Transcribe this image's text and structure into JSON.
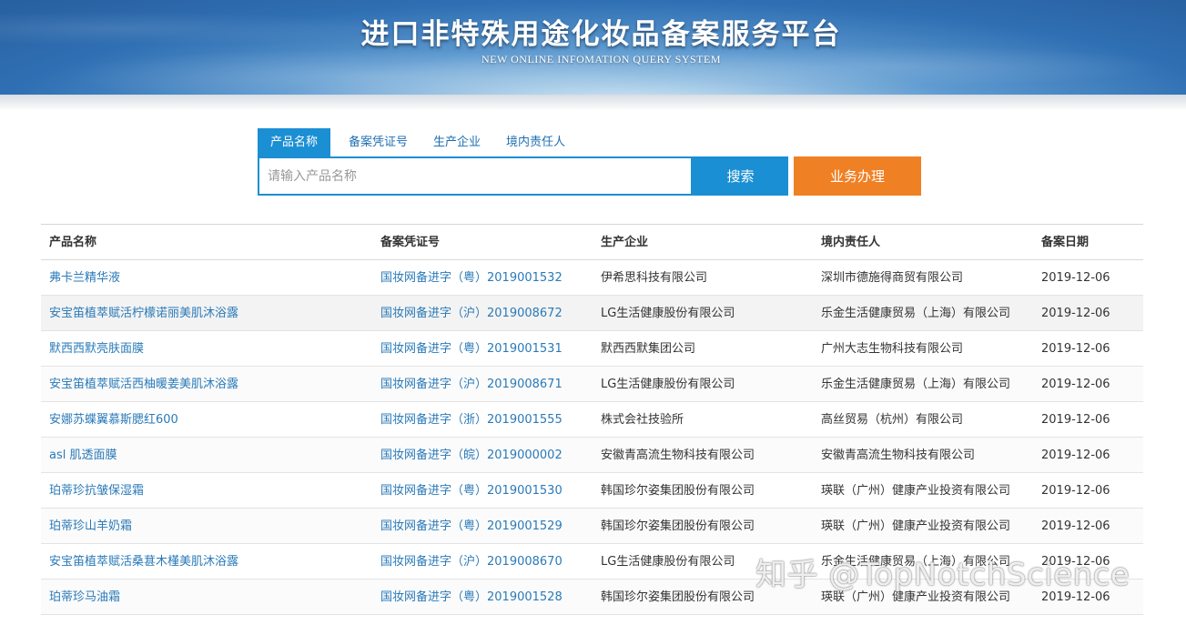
{
  "header": {
    "title": "进口非特殊用途化妆品备案服务平台",
    "subtitle": "NEW ONLINE INFOMATION QUERY SYSTEM"
  },
  "tabs": [
    {
      "label": "产品名称",
      "active": true
    },
    {
      "label": "备案凭证号",
      "active": false
    },
    {
      "label": "生产企业",
      "active": false
    },
    {
      "label": "境内责任人",
      "active": false
    }
  ],
  "search": {
    "placeholder": "请输入产品名称",
    "value": "",
    "button_label": "搜索"
  },
  "business_button_label": "业务办理",
  "colors": {
    "accent_blue": "#1b8fd3",
    "accent_orange": "#f08024",
    "link_blue": "#2a7ab8"
  },
  "table": {
    "columns": [
      "产品名称",
      "备案凭证号",
      "生产企业",
      "境内责任人",
      "备案日期"
    ],
    "rows": [
      {
        "name": "弗卡兰精华液",
        "cert": "国妆网备进字（粤）2019001532",
        "maker": "伊希思科技有限公司",
        "agent": "深圳市德施得商贸有限公司",
        "date": "2019-12-06"
      },
      {
        "name": "安宝笛植萃赋活柠檬诺丽美肌沐浴露",
        "cert": "国妆网备进字（沪）2019008672",
        "maker": "LG生活健康股份有限公司",
        "agent": "乐金生活健康贸易（上海）有限公司",
        "date": "2019-12-06"
      },
      {
        "name": "默西西默亮肤面膜",
        "cert": "国妆网备进字（粤）2019001531",
        "maker": "默西西默集团公司",
        "agent": "广州大志生物科技有限公司",
        "date": "2019-12-06"
      },
      {
        "name": "安宝笛植萃赋活西柚暖姜美肌沐浴露",
        "cert": "国妆网备进字（沪）2019008671",
        "maker": "LG生活健康股份有限公司",
        "agent": "乐金生活健康贸易（上海）有限公司",
        "date": "2019-12-06"
      },
      {
        "name": "安娜苏蝶翼慕斯腮红600",
        "cert": "国妆网备进字（浙）2019001555",
        "maker": "株式会社技验所",
        "agent": "高丝贸易（杭州）有限公司",
        "date": "2019-12-06"
      },
      {
        "name": "asl 肌透面膜",
        "cert": "国妆网备进字（皖）2019000002",
        "maker": "安徽青高流生物科技有限公司",
        "agent": "安徽青高流生物科技有限公司",
        "date": "2019-12-06"
      },
      {
        "name": "珀蒂珍抗皱保湿霜",
        "cert": "国妆网备进字（粤）2019001530",
        "maker": "韩国珍尔姿集团股份有限公司",
        "agent": "瑛联（广州）健康产业投资有限公司",
        "date": "2019-12-06"
      },
      {
        "name": "珀蒂珍山羊奶霜",
        "cert": "国妆网备进字（粤）2019001529",
        "maker": "韩国珍尔姿集团股份有限公司",
        "agent": "瑛联（广州）健康产业投资有限公司",
        "date": "2019-12-06"
      },
      {
        "name": "安宝笛植萃赋活桑葚木槿美肌沐浴露",
        "cert": "国妆网备进字（沪）2019008670",
        "maker": "LG生活健康股份有限公司",
        "agent": "乐金生活健康贸易（上海）有限公司",
        "date": "2019-12-06"
      },
      {
        "name": "珀蒂珍马油霜",
        "cert": "国妆网备进字（粤）2019001528",
        "maker": "韩国珍尔姿集团股份有限公司",
        "agent": "瑛联（广州）健康产业投资有限公司",
        "date": "2019-12-06"
      }
    ]
  },
  "watermark": "知乎 @TopNotchScience"
}
